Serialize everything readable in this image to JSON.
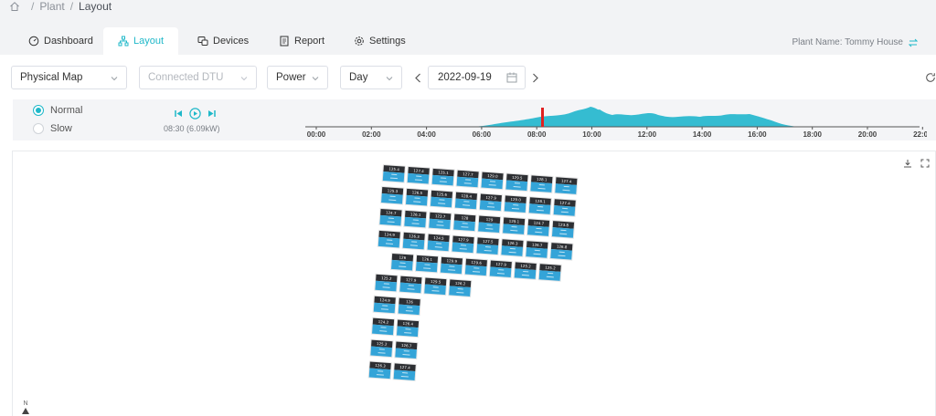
{
  "breadcrumb": {
    "items": [
      "Plant",
      "Layout"
    ]
  },
  "tabs": [
    {
      "label": "Dashboard",
      "icon": "gauge-icon"
    },
    {
      "label": "Layout",
      "icon": "sitemap-icon",
      "active": true
    },
    {
      "label": "Devices",
      "icon": "devices-icon"
    },
    {
      "label": "Report",
      "icon": "report-icon"
    },
    {
      "label": "Settings",
      "icon": "gear-icon"
    }
  ],
  "plant": {
    "label": "Plant Name: Tommy House"
  },
  "toolbar": {
    "view": "Physical Map",
    "dtu": "Connected DTU",
    "metric": "Power",
    "period": "Day",
    "date": "2022-09-19"
  },
  "timeline": {
    "speed_normal": "Normal",
    "speed_slow": "Slow",
    "current": "08:30 (6.09kW)",
    "ticks": [
      "00:00",
      "02:00",
      "04:00",
      "06:00",
      "08:00",
      "10:00",
      "12:00",
      "14:00",
      "16:00",
      "18:00",
      "20:00",
      "22:00"
    ],
    "colors": {
      "accent": "#1fb8c9",
      "marker": "#e02020"
    }
  },
  "map": {
    "north_label": "N",
    "rows": [
      [
        "125.4",
        "127.4",
        "125.1",
        "127.7",
        "129.0",
        "129.5",
        "128.1",
        "127.4"
      ],
      [
        "125.3",
        "126.5",
        "125.6",
        "128.4",
        "127.9",
        "129.0",
        "128.1",
        "127.4"
      ],
      [
        "124.7",
        "126.1",
        "123.7",
        "128",
        "129",
        "129.1",
        "124.7",
        "123.8"
      ],
      [
        "124.9",
        "126.3",
        "124.5",
        "127.9",
        "127.5",
        "126.3",
        "126.7",
        "126.8"
      ],
      [
        "126",
        "126.1",
        "129.9",
        "129.6",
        "127.9",
        "125.2",
        "125.2"
      ],
      [
        "125.2",
        "127.9",
        "129.5",
        "126.2"
      ],
      [
        "124.9",
        "126"
      ],
      [
        "124.2",
        "126.4"
      ],
      [
        "125.2",
        "126.7"
      ],
      [
        "126.3",
        "127.4"
      ]
    ]
  }
}
